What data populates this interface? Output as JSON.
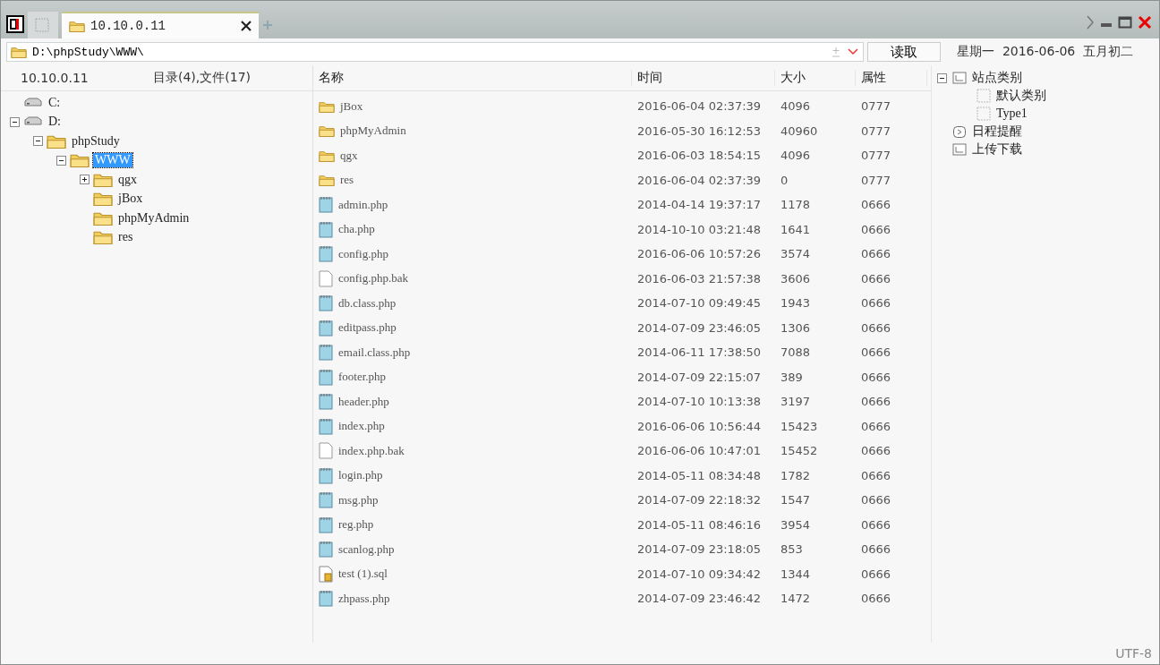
{
  "tabs": [
    {
      "kind": "blank",
      "selected": false
    },
    {
      "kind": "folder",
      "label": "10.10.0.11",
      "selected": true
    }
  ],
  "address": {
    "value": "D:\\phpStudy\\WWW\\",
    "button": "读取"
  },
  "date": "星期一  2016-06-06  五月初二",
  "left_header": {
    "host": "10.10.0.11",
    "summary": "目录(4),文件(17)"
  },
  "tree": [
    {
      "kind": "drive",
      "label": "C:",
      "selected": false
    },
    {
      "kind": "drive",
      "label": "D:",
      "expanded": true,
      "selected": false,
      "children": [
        {
          "kind": "folder",
          "label": "phpStudy",
          "expanded": true,
          "selected": false,
          "children": [
            {
              "kind": "folder",
              "label": "WWW",
              "expanded": true,
              "selected": true,
              "children": [
                {
                  "kind": "folder",
                  "label": "qgx",
                  "expanded": false,
                  "selected": false
                },
                {
                  "kind": "folder",
                  "label": "jBox",
                  "selected": false
                },
                {
                  "kind": "folder",
                  "label": "phpMyAdmin",
                  "selected": false
                },
                {
                  "kind": "folder",
                  "label": "res",
                  "selected": false
                }
              ]
            }
          ]
        }
      ]
    }
  ],
  "table": {
    "columns": [
      "名称",
      "时间",
      "大小",
      "属性"
    ],
    "rows": [
      {
        "kind": "folder",
        "name": "jBox",
        "time": "2016-06-04 02:37:39",
        "size": "4096",
        "attr": "0777"
      },
      {
        "kind": "folder",
        "name": "phpMyAdmin",
        "time": "2016-05-30 16:12:53",
        "size": "40960",
        "attr": "0777"
      },
      {
        "kind": "folder",
        "name": "qgx",
        "time": "2016-06-03 18:54:15",
        "size": "4096",
        "attr": "0777"
      },
      {
        "kind": "folder",
        "name": "res",
        "time": "2016-06-04 02:37:39",
        "size": "0",
        "attr": "0777"
      },
      {
        "kind": "script",
        "name": "admin.php",
        "time": "2014-04-14 19:37:17",
        "size": "1178",
        "attr": "0666"
      },
      {
        "kind": "script",
        "name": "cha.php",
        "time": "2014-10-10 03:21:48",
        "size": "1641",
        "attr": "0666"
      },
      {
        "kind": "script",
        "name": "config.php",
        "time": "2016-06-06 10:57:26",
        "size": "3574",
        "attr": "0666"
      },
      {
        "kind": "blank",
        "name": "config.php.bak",
        "time": "2016-06-03 21:57:38",
        "size": "3606",
        "attr": "0666"
      },
      {
        "kind": "script",
        "name": "db.class.php",
        "time": "2014-07-10 09:49:45",
        "size": "1943",
        "attr": "0666"
      },
      {
        "kind": "script",
        "name": "editpass.php",
        "time": "2014-07-09 23:46:05",
        "size": "1306",
        "attr": "0666"
      },
      {
        "kind": "script",
        "name": "email.class.php",
        "time": "2014-06-11 17:38:50",
        "size": "7088",
        "attr": "0666"
      },
      {
        "kind": "script",
        "name": "footer.php",
        "time": "2014-07-09 22:15:07",
        "size": "389",
        "attr": "0666"
      },
      {
        "kind": "script",
        "name": "header.php",
        "time": "2014-07-10 10:13:38",
        "size": "3197",
        "attr": "0666"
      },
      {
        "kind": "script",
        "name": "index.php",
        "time": "2016-06-06 10:56:44",
        "size": "15423",
        "attr": "0666"
      },
      {
        "kind": "blank",
        "name": "index.php.bak",
        "time": "2016-06-06 10:47:01",
        "size": "15452",
        "attr": "0666"
      },
      {
        "kind": "script",
        "name": "login.php",
        "time": "2014-05-11 08:34:48",
        "size": "1782",
        "attr": "0666"
      },
      {
        "kind": "script",
        "name": "msg.php",
        "time": "2014-07-09 22:18:32",
        "size": "1547",
        "attr": "0666"
      },
      {
        "kind": "script",
        "name": "reg.php",
        "time": "2014-05-11 08:46:16",
        "size": "3954",
        "attr": "0666"
      },
      {
        "kind": "script",
        "name": "scanlog.php",
        "time": "2014-07-09 23:18:05",
        "size": "853",
        "attr": "0666"
      },
      {
        "kind": "sql",
        "name": "test (1).sql",
        "time": "2014-07-10 09:34:42",
        "size": "1344",
        "attr": "0666"
      },
      {
        "kind": "script",
        "name": "zhpass.php",
        "time": "2014-07-09 23:46:42",
        "size": "1472",
        "attr": "0666"
      }
    ]
  },
  "side_tree": [
    {
      "kind": "group",
      "label": "站点类别",
      "expanded": true,
      "children": [
        {
          "label": "默认类别"
        },
        {
          "label": "Type1"
        }
      ]
    },
    {
      "kind": "clock",
      "label": "日程提醒"
    },
    {
      "kind": "group",
      "label": "上传下载"
    }
  ],
  "status_bar": {
    "encoding": "UTF-8"
  }
}
